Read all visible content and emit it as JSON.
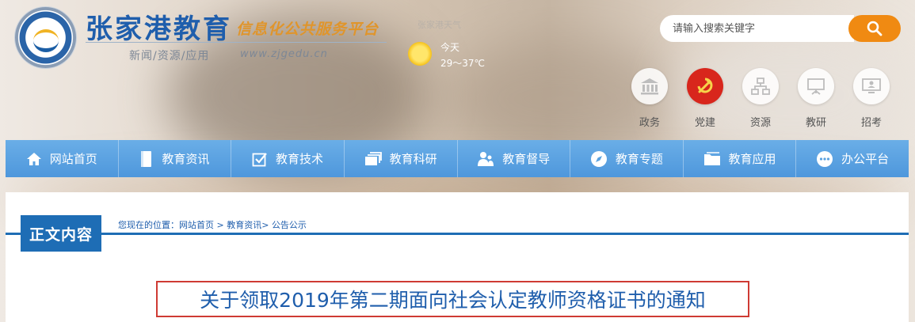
{
  "header": {
    "site_title": "张家港教育",
    "site_subtitle": "信息化公共服务平台",
    "tagline": "新闻/资源/应用",
    "url": "www.zjgedu.cn"
  },
  "weather": {
    "label": "张家港天气",
    "day": "今天",
    "temp": "29～37℃",
    "icon": "sun-icon"
  },
  "search": {
    "placeholder": "请输入搜索关键字",
    "button_icon": "search-icon"
  },
  "quick_links": [
    {
      "label": "政务",
      "icon": "government-building-icon"
    },
    {
      "label": "党建",
      "icon": "party-emblem-icon"
    },
    {
      "label": "资源",
      "icon": "hierarchy-icon"
    },
    {
      "label": "教研",
      "icon": "presentation-board-icon"
    },
    {
      "label": "招考",
      "icon": "exam-computer-icon"
    }
  ],
  "nav": [
    {
      "label": "网站首页",
      "icon": "home-icon"
    },
    {
      "label": "教育资讯",
      "icon": "book-icon"
    },
    {
      "label": "教育技术",
      "icon": "checkbox-icon"
    },
    {
      "label": "教育科研",
      "icon": "stacked-cards-icon"
    },
    {
      "label": "教育督导",
      "icon": "users-icon"
    },
    {
      "label": "教育专题",
      "icon": "compass-icon"
    },
    {
      "label": "教育应用",
      "icon": "folder-icon"
    },
    {
      "label": "办公平台",
      "icon": "chat-icon"
    }
  ],
  "content": {
    "section_title": "正文内容",
    "breadcrumb_prefix": "您现在的位置：",
    "breadcrumb": [
      "网站首页",
      "教育资讯",
      "公告公示"
    ],
    "breadcrumb_sep1": " > ",
    "breadcrumb_sep2": "> ",
    "article_title": "关于领取2019年第二期面向社会认定教师资格证书的通知"
  },
  "colors": {
    "brand_blue": "#1f5eac",
    "nav_blue": "#5aa2e0",
    "search_orange": "#f08a12",
    "title_border": "#cf3b34"
  }
}
